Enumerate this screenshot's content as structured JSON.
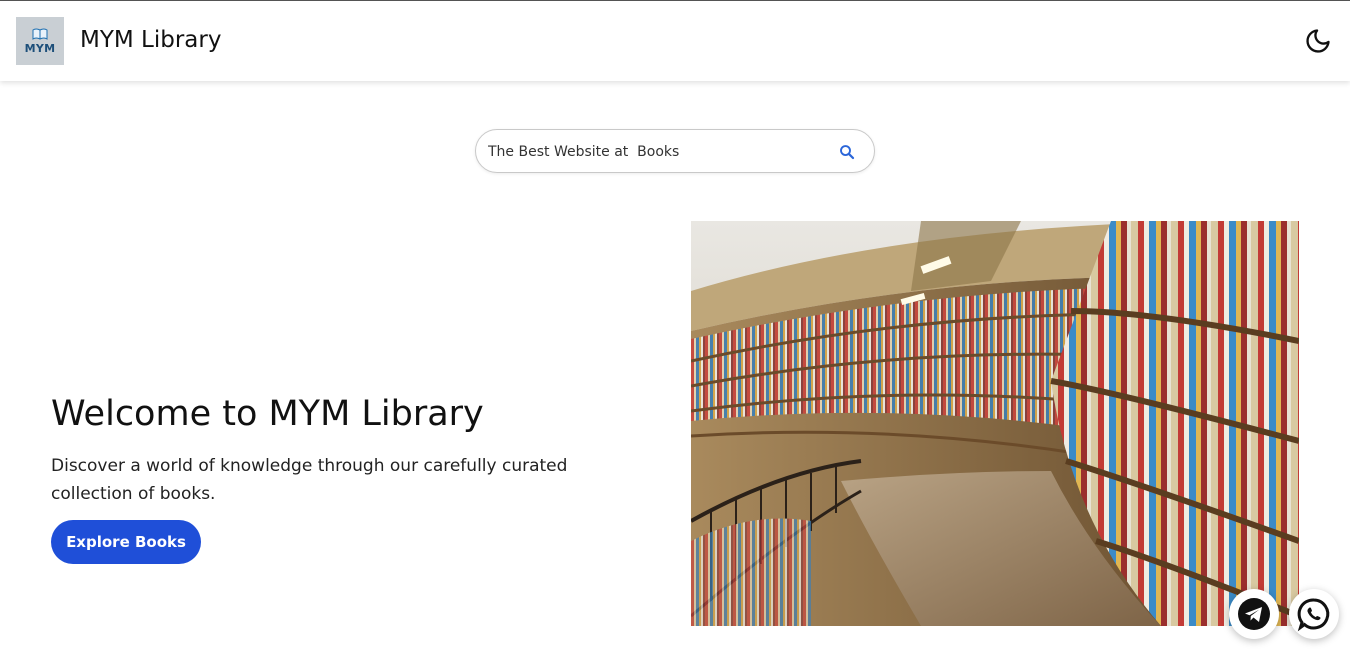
{
  "header": {
    "logo_text": "MYM",
    "site_title": "MYM Library",
    "theme_toggle_icon": "moon-icon"
  },
  "search": {
    "value": "The Best Website at  Books",
    "icon": "search-icon",
    "icon_color": "#2b66d9"
  },
  "hero": {
    "title": "Welcome to MYM Library",
    "description": "Discover a world of knowledge through our carefully curated collection of books.",
    "button_label": "Explore Books",
    "button_color": "#1f4fd8",
    "image_subject": "library-bookshelves"
  },
  "floating_actions": [
    {
      "icon": "telegram-icon"
    },
    {
      "icon": "whatsapp-icon"
    }
  ]
}
